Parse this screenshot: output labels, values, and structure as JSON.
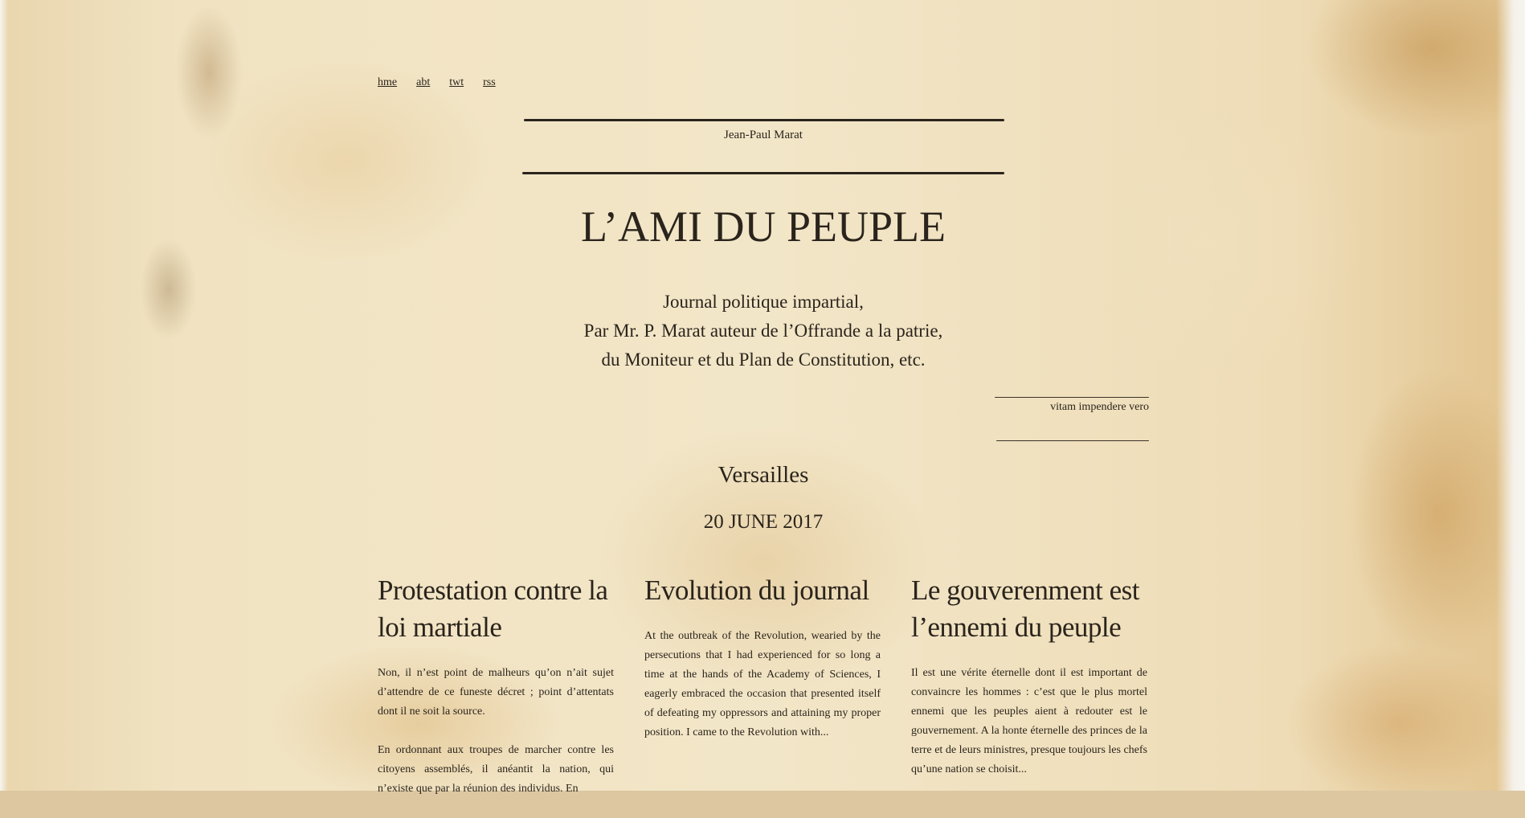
{
  "nav": {
    "items": [
      {
        "label": "hme"
      },
      {
        "label": "abt"
      },
      {
        "label": "twt"
      },
      {
        "label": "rss"
      }
    ]
  },
  "header": {
    "author": "Jean-Paul Marat",
    "title": "L’AMI DU PEUPLE",
    "subtitle_lines": [
      "Journal politique impartial,",
      "Par Mr. P. Marat auteur de l’Offrande a la patrie,",
      "du Moniteur et du Plan de Constitution, etc."
    ],
    "motto": "vitam impendere vero"
  },
  "issue": {
    "location": "Versailles",
    "date": "20 JUNE 2017"
  },
  "articles": [
    {
      "title": "Protestation contre la loi martiale",
      "paragraphs": [
        "Non, il n’est point de malheurs qu’on n’ait sujet d’attendre de ce funeste décret ; point d’attentats dont il ne soit la source.",
        "En ordonnant aux troupes de marcher contre les citoyens assemblés, il anéantit la nation, qui n’existe que par la réunion des individus. En"
      ]
    },
    {
      "title": "Evolution du journal",
      "paragraphs": [
        "At the outbreak of the Revolution, wearied by the persecutions that I had experienced for so long a time at the hands of the Academy of Sciences, I eagerly embraced the occasion that presented itself of defeating my oppressors and attaining my proper position. I came to the Revolution with..."
      ]
    },
    {
      "title": "Le gouverenment est l’ennemi du peuple",
      "paragraphs": [
        "Il est une vérite éternelle dont il est important de convaincre les hommes : c’est que le plus mortel ennemi que les peuples aient à redouter est le gouvernement. A la honte éternelle des princes de la terre et de leurs ministres, presque toujours les chefs qu’une nation se choisit..."
      ]
    }
  ]
}
